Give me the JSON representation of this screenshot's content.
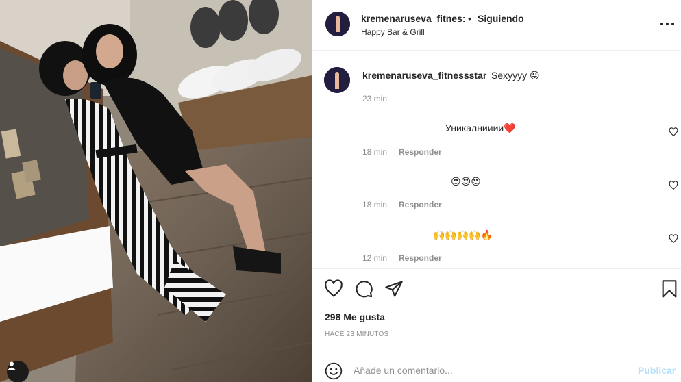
{
  "post": {
    "username": "kremenaruseva_fitnes:",
    "separator": "•",
    "follow_label": "Siguiendo",
    "location": "Happy Bar & Grill"
  },
  "caption": {
    "username": "kremenaruseva_fitnessstar",
    "text": "Sexyyyy 😛",
    "time": "23 min"
  },
  "comments": [
    {
      "text": "Уникалнииии❤️",
      "time": "18 min",
      "reply_label": "Responder"
    },
    {
      "text": "😍😍😍",
      "time": "18 min",
      "reply_label": "Responder"
    },
    {
      "text": "🙌🙌🙌🙌🔥",
      "time": "12 min",
      "reply_label": "Responder"
    }
  ],
  "likes_label": "298 Me gusta",
  "time_ago": "HACE 23 MINUTOS",
  "comment_box": {
    "placeholder": "Añade un comentario...",
    "publish_label": "Publicar"
  },
  "icons": [
    "heart-icon",
    "comment-icon",
    "share-icon",
    "bookmark-icon",
    "more-options-icon",
    "emoji-icon",
    "user-tag-icon"
  ],
  "colors": {
    "accent_disabled": "#b2dffc",
    "secondary_text": "#8e8e8e",
    "text": "#262626"
  }
}
